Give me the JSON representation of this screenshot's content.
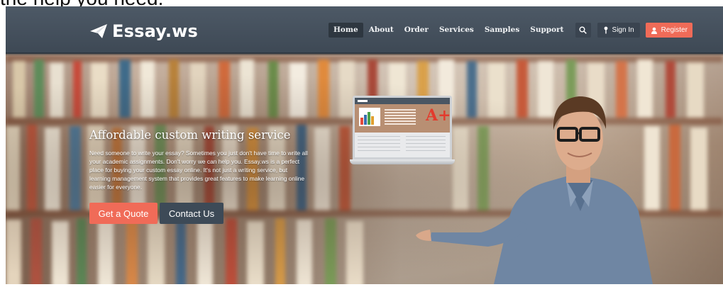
{
  "page_caption": "the help you need.",
  "header": {
    "logo_text": "Essay.ws",
    "nav": [
      "Home",
      "About",
      "Order",
      "Services",
      "Samples",
      "Support"
    ],
    "active_nav": "Home",
    "signin_label": "Sign In",
    "register_label": "Register"
  },
  "hero": {
    "title": "Affordable custom writing service",
    "text": "Need someone to write your essay? Sometimes you just don't have time to write all your academic assignments. Don't worry we can help you. Essay.ws is a perfect place for buying your custom essay online. It's not just a writing service, but learning management system that provides great features to make learning online easier for everyone.",
    "quote_button": "Get a Quote",
    "contact_button": "Contact Us",
    "laptop_grade": "A+"
  },
  "colors": {
    "header_bg": "#46525e",
    "accent": "#f06b58",
    "dark_button": "#3d4a57"
  },
  "icons": [
    "paper-plane-icon",
    "search-icon",
    "key-icon",
    "user-icon"
  ]
}
